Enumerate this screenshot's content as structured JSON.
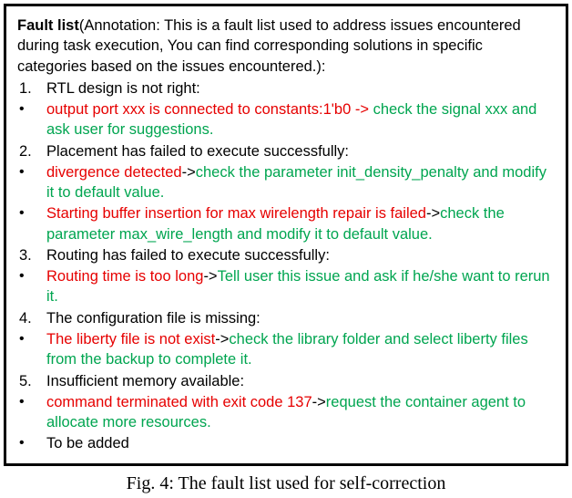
{
  "header": {
    "title": "Fault list",
    "annotation": "(Annotation: This is a fault list used to address issues encountered during task execution, You can find corresponding solutions in specific categories based on the issues encountered.):"
  },
  "items": {
    "n1": "1.",
    "n2": "2.",
    "n3": "3.",
    "n4": "4.",
    "n5": "5.",
    "bullet": "•",
    "cat1": "RTL design is not right:",
    "b1a_red": "output port xxx is connected to constants:1'b0 -> ",
    "b1a_green": "check the signal xxx and ask user for suggestions.",
    "cat2": "Placement has failed to execute successfully:",
    "b2a_red": "divergence detected",
    "arrow": "->",
    "b2a_green": "check the parameter init_density_penalty and modify it to default value.",
    "b2b_red": "Starting buffer insertion for max wirelength repair is failed",
    "b2b_green1": "check the parameter max_wire_length and modify it to default value",
    "b2b_green2": ".",
    "cat3": "Routing has failed to execute successfully:",
    "b3a_red": "Routing time is too long",
    "b3a_green": "Tell user this issue and ask if he/she want to rerun it.",
    "cat4": "The configuration file is missing:",
    "b4a_red": "The liberty file is not exist",
    "b4a_green": "check the library folder and select liberty files from the backup to complete it.",
    "cat5": "Insufficient memory available:",
    "b5a_red": "command terminated with exit code 137",
    "b5a_green": "request the container agent to allocate more resources.",
    "last": "To be added"
  },
  "caption": "Fig. 4: The fault list used for self-correction"
}
